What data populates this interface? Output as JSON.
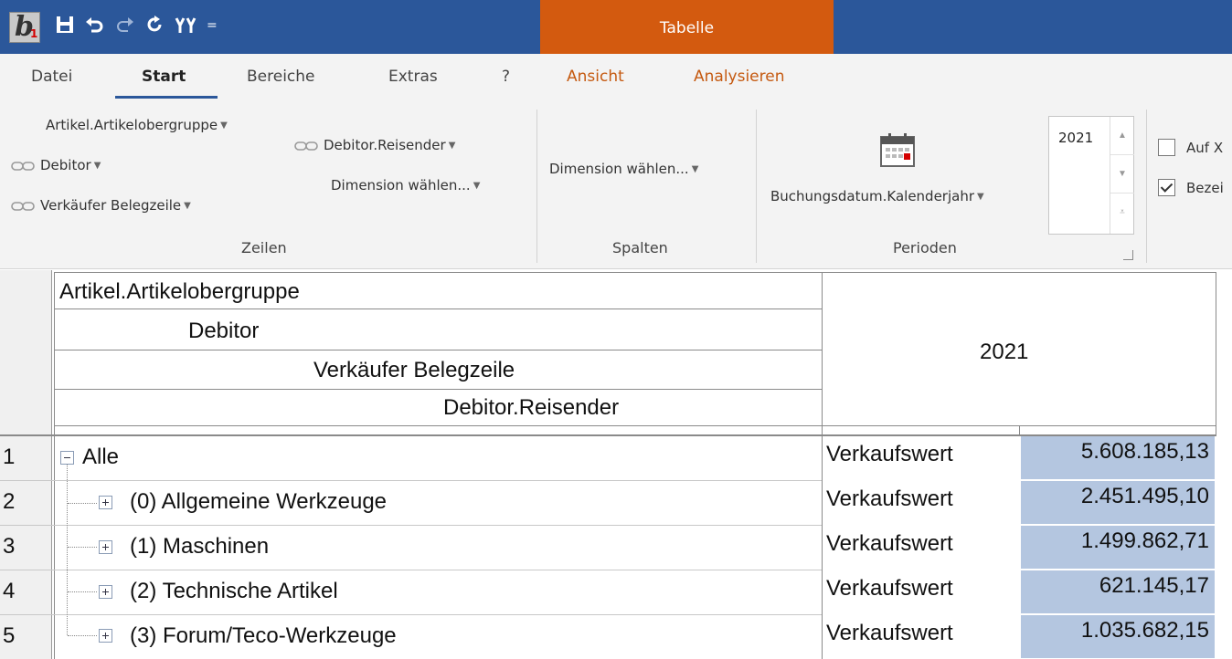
{
  "titlebar": {
    "context_tab": "Tabelle",
    "qat_more": "="
  },
  "logo": {
    "letter": "b",
    "sub": "1"
  },
  "tabs": [
    {
      "label": "Datei"
    },
    {
      "label": "Start"
    },
    {
      "label": "Bereiche"
    },
    {
      "label": "Extras"
    },
    {
      "label": "?"
    },
    {
      "label": "Ansicht"
    },
    {
      "label": "Analysieren"
    }
  ],
  "ribbon": {
    "zeilen": {
      "items": [
        "Artikel.Artikelobergruppe",
        "Debitor",
        "Verkäufer Belegzeile",
        "Debitor.Reisender",
        "Dimension wählen..."
      ],
      "label": "Zeilen"
    },
    "spalten": {
      "item": "Dimension wählen...",
      "label": "Spalten"
    },
    "perioden": {
      "item": "Buchungsdatum.Kalenderjahr",
      "year": "2021",
      "label": "Perioden"
    },
    "options": {
      "auf": "Auf X",
      "bez": "Bezei"
    }
  },
  "grid": {
    "header_levels": [
      "Artikel.Artikelobergruppe",
      "Debitor",
      "Verkäufer Belegzeile",
      "Debitor.Reisender"
    ],
    "column_header": "2021",
    "rows": [
      {
        "num": "1",
        "label": "Alle",
        "measure": "Verkaufswert",
        "value": "5.608.185,13"
      },
      {
        "num": "2",
        "label": "(0) Allgemeine Werkzeuge",
        "measure": "Verkaufswert",
        "value": "2.451.495,10"
      },
      {
        "num": "3",
        "label": "(1) Maschinen",
        "measure": "Verkaufswert",
        "value": "1.499.862,71"
      },
      {
        "num": "4",
        "label": "(2) Technische Artikel",
        "measure": "Verkaufswert",
        "value": "621.145,17"
      },
      {
        "num": "5",
        "label": "(3) Forum/Teco-Werkzeuge",
        "measure": "Verkaufswert",
        "value": "1.035.682,15"
      }
    ]
  }
}
